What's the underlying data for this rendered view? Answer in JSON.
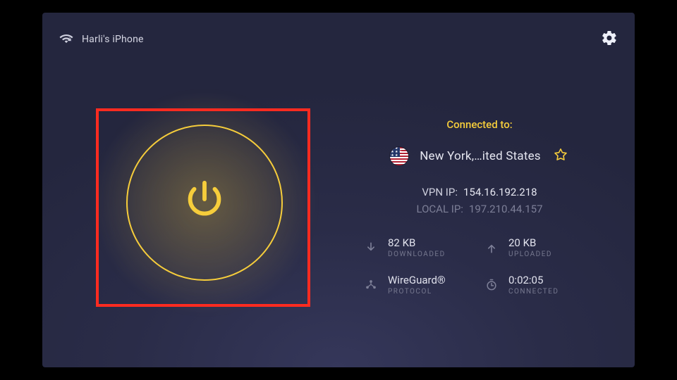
{
  "header": {
    "device": "Harli's iPhone"
  },
  "status": {
    "connected_to_label": "Connected to:",
    "location": "New York,…ited States"
  },
  "ip": {
    "vpn_label": "VPN IP:",
    "vpn_value": "154.16.192.218",
    "local_label": "LOCAL IP:",
    "local_value": "197.210.44.157"
  },
  "stats": {
    "download_value": "82 KB",
    "download_label": "Downloaded",
    "upload_value": "20 KB",
    "upload_label": "Uploaded",
    "protocol_value": "WireGuard®",
    "protocol_label": "Protocol",
    "time_value": "0:02:05",
    "time_label": "Connected"
  }
}
